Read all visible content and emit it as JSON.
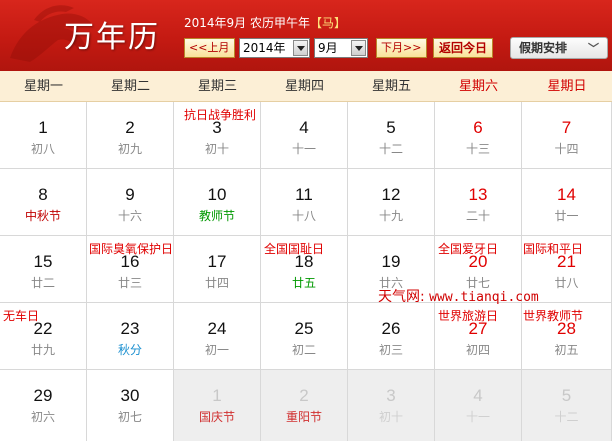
{
  "header": {
    "app_title": "万年历",
    "lunar_prefix": "2014年9月 农历甲午年",
    "zodiac": "【马】",
    "prev_button": "<<上月",
    "year_select": "2014年",
    "month_select": "9月",
    "next_button": "下月>>",
    "today_button": "返回今日",
    "holiday_button": "假期安排"
  },
  "weekdays": [
    "星期一",
    "星期二",
    "星期三",
    "星期四",
    "星期五",
    "星期六",
    "星期日"
  ],
  "weeks": [
    [
      {
        "day": "1",
        "lunar": "初八"
      },
      {
        "day": "2",
        "lunar": "初九"
      },
      {
        "day": "3",
        "lunar": "初十",
        "event": "抗日战争胜利"
      },
      {
        "day": "4",
        "lunar": "十一"
      },
      {
        "day": "5",
        "lunar": "十二"
      },
      {
        "day": "6",
        "lunar": "十三"
      },
      {
        "day": "7",
        "lunar": "十四"
      }
    ],
    [
      {
        "day": "8",
        "lunar": "中秋节",
        "lunar_style": "festival-red"
      },
      {
        "day": "9",
        "lunar": "十六"
      },
      {
        "day": "10",
        "lunar": "教师节",
        "lunar_style": "term-green"
      },
      {
        "day": "11",
        "lunar": "十八"
      },
      {
        "day": "12",
        "lunar": "十九"
      },
      {
        "day": "13",
        "lunar": "二十"
      },
      {
        "day": "14",
        "lunar": "廿一"
      }
    ],
    [
      {
        "day": "15",
        "lunar": "廿二"
      },
      {
        "day": "16",
        "lunar": "廿三",
        "event": "国际臭氧保护日"
      },
      {
        "day": "17",
        "lunar": "廿四"
      },
      {
        "day": "18",
        "lunar": "廿五",
        "lunar_style": "lunar-green",
        "event": "全国国耻日"
      },
      {
        "day": "19",
        "lunar": "廿六"
      },
      {
        "day": "20",
        "lunar": "廿七",
        "event": "全国爱牙日"
      },
      {
        "day": "21",
        "lunar": "廿八",
        "event": "国际和平日"
      }
    ],
    [
      {
        "day": "22",
        "lunar": "廿九",
        "event": "无车日"
      },
      {
        "day": "23",
        "lunar": "秋分",
        "lunar_style": "term-blue"
      },
      {
        "day": "24",
        "lunar": "初一"
      },
      {
        "day": "25",
        "lunar": "初二"
      },
      {
        "day": "26",
        "lunar": "初三"
      },
      {
        "day": "27",
        "lunar": "初四",
        "event": "世界旅游日"
      },
      {
        "day": "28",
        "lunar": "初五",
        "event": "世界教师节"
      }
    ],
    [
      {
        "day": "29",
        "lunar": "初六"
      },
      {
        "day": "30",
        "lunar": "初七"
      },
      {
        "day": "1",
        "lunar": "国庆节",
        "lunar_style": "festival-red",
        "other_month": true
      },
      {
        "day": "2",
        "lunar": "重阳节",
        "lunar_style": "festival-red",
        "other_month": true
      },
      {
        "day": "3",
        "lunar": "初十",
        "other_month": true
      },
      {
        "day": "4",
        "lunar": "十一",
        "other_month": true
      },
      {
        "day": "5",
        "lunar": "十二",
        "other_month": true
      }
    ]
  ],
  "watermark": {
    "site": "天气网:",
    "url": "www.tianqi.com"
  },
  "colors": {
    "header_red": "#c41a12",
    "weekday_bar": "#fcefd6",
    "weekend_red": "#e00000",
    "event_red": "#e00000",
    "term_green": "#009900",
    "term_blue": "#1a8fd0"
  }
}
